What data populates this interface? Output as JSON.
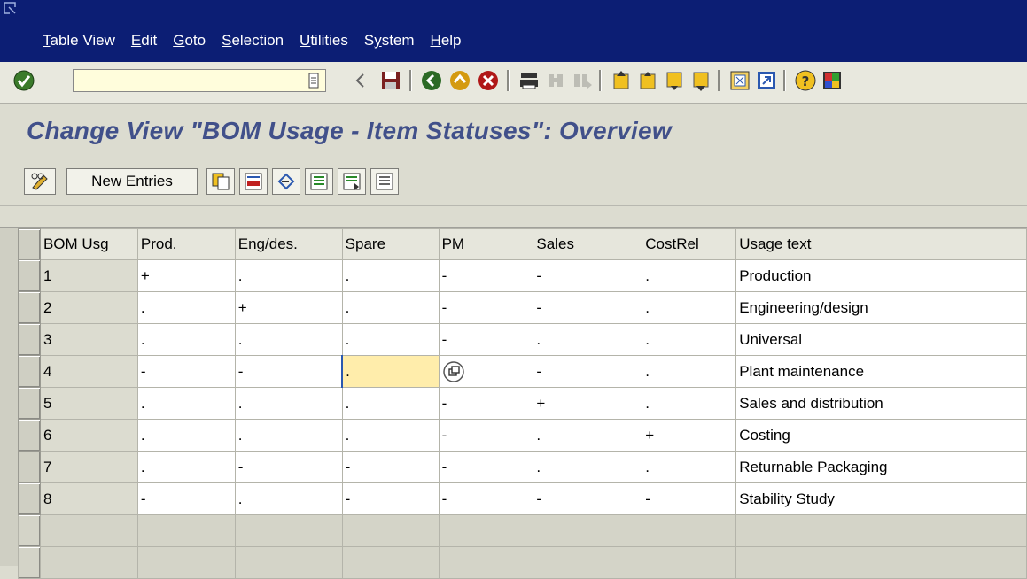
{
  "menu": [
    "Table View",
    "Edit",
    "Goto",
    "Selection",
    "Utilities",
    "System",
    "Help"
  ],
  "menu_mnemonic": [
    "T",
    "E",
    "G",
    "S",
    "U",
    "y",
    "H"
  ],
  "command_field": {
    "value": "",
    "placeholder": ""
  },
  "page_title": "Change View \"BOM Usage - Item Statuses\": Overview",
  "app_toolbar": {
    "new_entries_label": "New Entries"
  },
  "table": {
    "columns": [
      "BOM Usg",
      "Prod.",
      "Eng/des.",
      "Spare",
      "PM",
      "Sales",
      "CostRel",
      "Usage text"
    ],
    "rows": [
      [
        "1",
        "+",
        ".",
        ".",
        "-",
        "-",
        ".",
        "Production"
      ],
      [
        "2",
        ".",
        "+",
        ".",
        "-",
        "-",
        ".",
        "Engineering/design"
      ],
      [
        "3",
        ".",
        ".",
        ".",
        "-",
        ".",
        ".",
        "Universal"
      ],
      [
        "4",
        "-",
        "-",
        ".",
        "",
        "-",
        ".",
        "Plant maintenance"
      ],
      [
        "5",
        ".",
        ".",
        ".",
        "-",
        "+",
        ".",
        "Sales and distribution"
      ],
      [
        "6",
        ".",
        ".",
        ".",
        "-",
        ".",
        "+",
        "Costing"
      ],
      [
        "7",
        ".",
        "-",
        "-",
        "-",
        ".",
        ".",
        "Returnable Packaging"
      ],
      [
        "8",
        "-",
        ".",
        "-",
        "-",
        "-",
        "-",
        "Stability Study"
      ]
    ]
  },
  "colors": {
    "menubar": "#0c1e74",
    "title": "#41508a",
    "focus": "#ffedab",
    "background": "#dcdcd0"
  }
}
